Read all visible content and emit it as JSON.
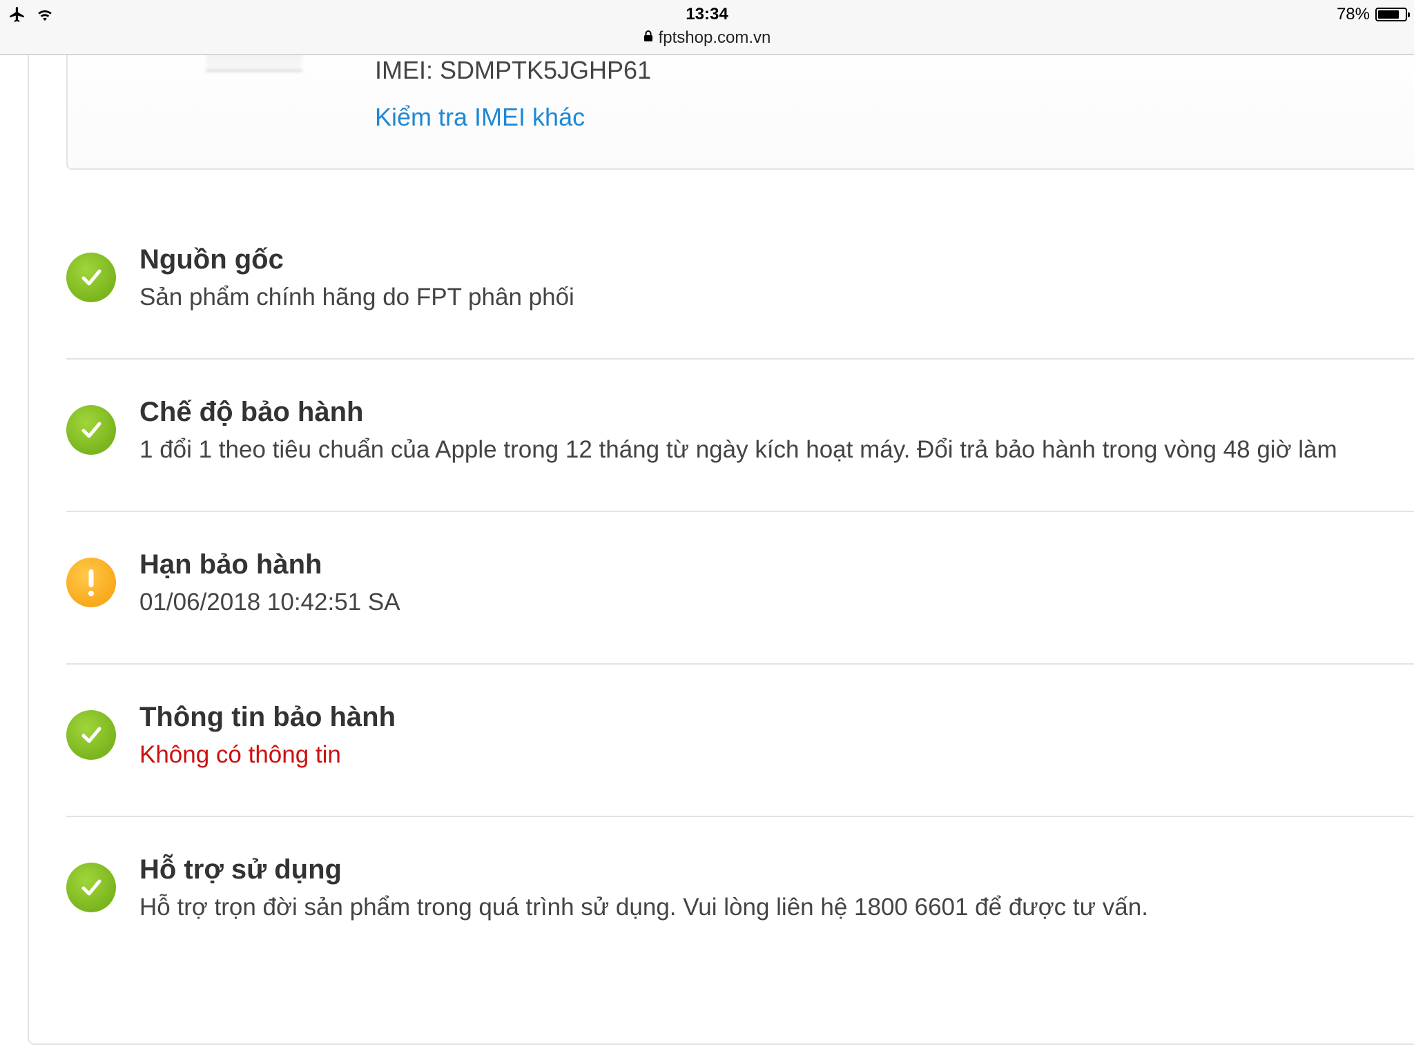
{
  "status_bar": {
    "time": "13:34",
    "url": "fptshop.com.vn",
    "battery_percent": "78%",
    "battery_level": 0.78
  },
  "imei_card": {
    "imei_text": "IMEI: SDMPTK5JGHP61",
    "check_other_link": "Kiểm tra IMEI khác"
  },
  "items": [
    {
      "status": "ok",
      "title": "Nguồn gốc",
      "description": "Sản phẩm chính hãng do FPT phân phối"
    },
    {
      "status": "ok",
      "title": "Chế độ bảo hành",
      "description": "1 đổi 1 theo tiêu chuẩn của Apple trong 12 tháng từ ngày kích hoạt máy. Đổi trả bảo hành trong vòng 48 giờ làm"
    },
    {
      "status": "warning",
      "title": "Hạn bảo hành",
      "description": "01/06/2018 10:42:51 SA"
    },
    {
      "status": "ok",
      "title": "Thông tin bảo hành",
      "description": "Không có thông tin",
      "description_color": "#cc1010"
    },
    {
      "status": "ok",
      "title": "Hỗ trợ sử dụng",
      "description": "Hỗ trợ trọn đời sản phẩm trong quá trình sử dụng. Vui lòng liên hệ 1800 6601 để được tư vấn."
    }
  ],
  "icons": {
    "ok": "checkmark-circle-icon",
    "warning": "exclamation-circle-icon"
  },
  "colors": {
    "link": "#1e88d4",
    "ok_green": "#86c12a",
    "warning_orange": "#fbb124",
    "alert_red": "#cc1010"
  }
}
